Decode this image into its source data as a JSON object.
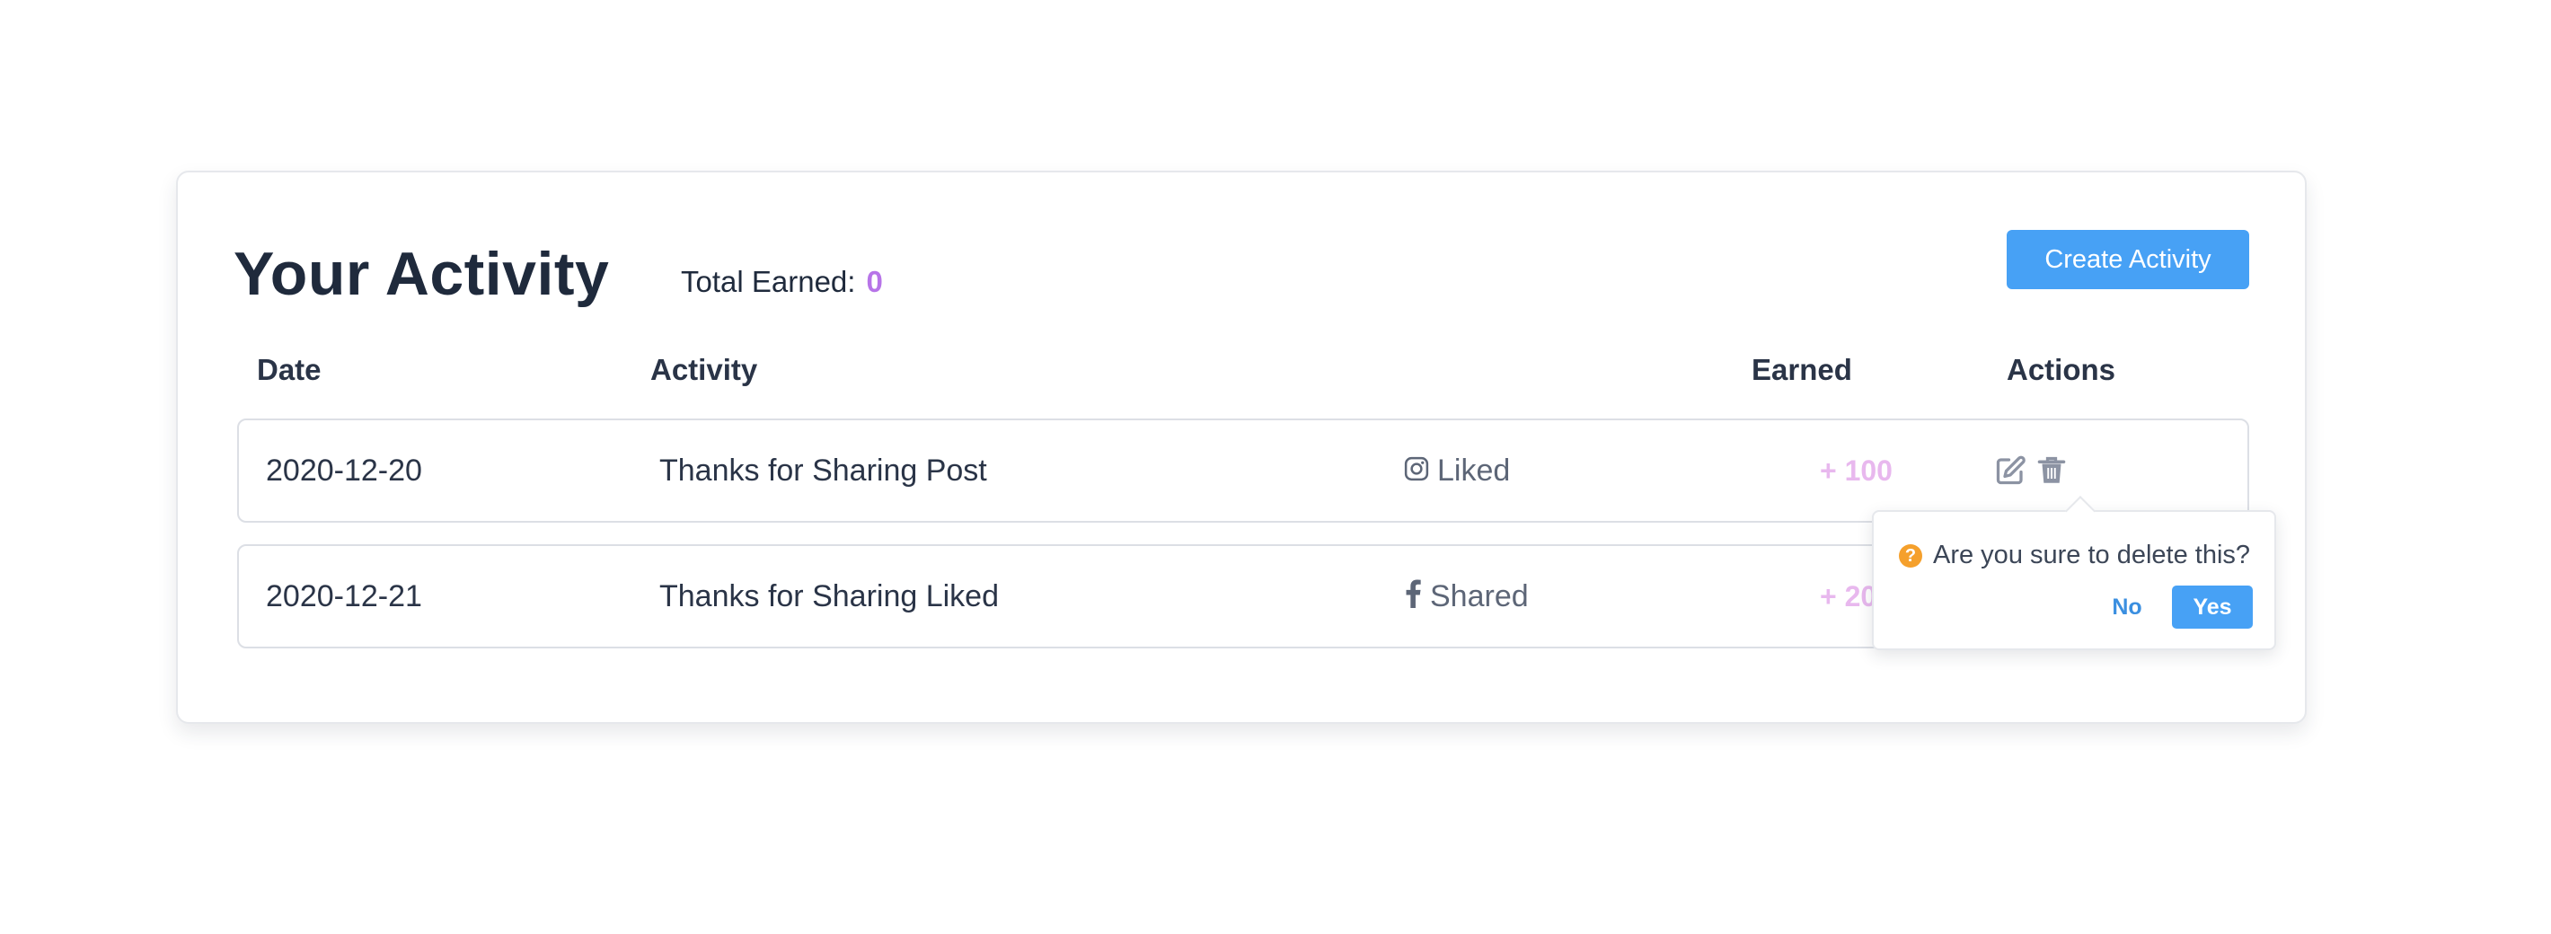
{
  "header": {
    "title": "Your Activity",
    "total_label": "Total Earned:",
    "total_value": "0",
    "create_button": "Create Activity"
  },
  "table": {
    "columns": [
      "Date",
      "Activity",
      "Earned",
      "Actions"
    ],
    "rows": [
      {
        "date": "2020-12-20",
        "activity": "Thanks for Sharing Post",
        "platform_icon": "instagram-icon",
        "platform_label": "Liked",
        "earned": "+ 100",
        "actions": [
          "edit-icon",
          "trash-icon"
        ]
      },
      {
        "date": "2020-12-21",
        "activity": "Thanks for Sharing Liked",
        "platform_icon": "facebook-icon",
        "platform_label": "Shared",
        "earned": "+ 200",
        "actions": []
      }
    ]
  },
  "popconfirm": {
    "icon": "question-icon",
    "message": "Are you sure to delete this?",
    "no_label": "No",
    "yes_label": "Yes"
  },
  "colors": {
    "primary": "#47a1f5",
    "heading": "#1f2a3c",
    "total_value": "#b774e8",
    "earned": "#e8b8ee",
    "warning": "#f5a02c"
  }
}
